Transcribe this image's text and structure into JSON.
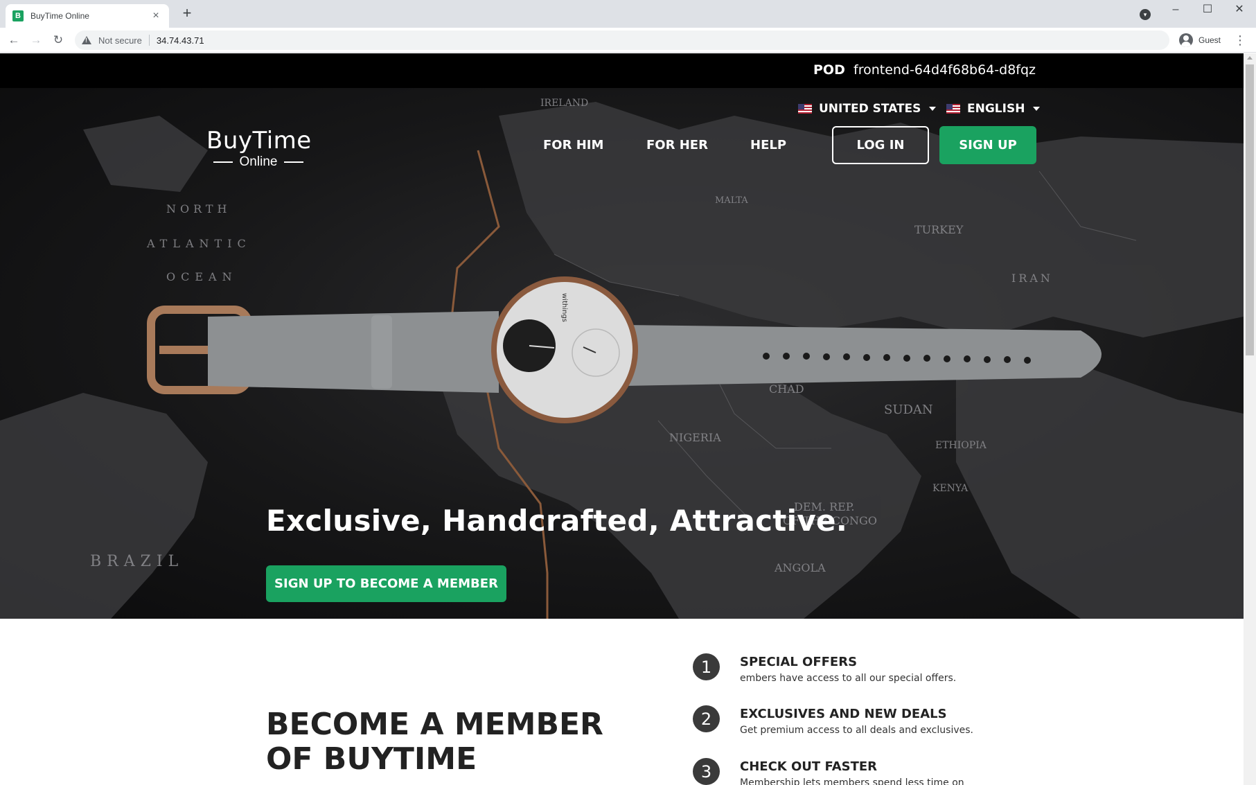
{
  "browser": {
    "tab_title": "BuyTime Online",
    "favicon_letter": "B",
    "security_label": "Not secure",
    "url": "34.74.43.71",
    "profile_label": "Guest"
  },
  "pod": {
    "label": "POD",
    "value": "frontend-64d4f68b64-d8fqz"
  },
  "topnav": {
    "country": "UNITED STATES",
    "language": "ENGLISH"
  },
  "brand": {
    "name": "BuyTime",
    "sub": "Online"
  },
  "nav": {
    "for_him": "FOR HIM",
    "for_her": "FOR HER",
    "help": "HELP",
    "login": "LOG IN",
    "signup": "SIGN UP"
  },
  "hero": {
    "headline": "Exclusive, Handcrafted, Attractive.",
    "cta": "SIGN UP TO BECOME A MEMBER",
    "watch_brand": "withings"
  },
  "member": {
    "title_line1": "BECOME A MEMBER",
    "title_line2": "OF BUYTIME",
    "features": [
      {
        "num": "1",
        "title": "SPECIAL OFFERS",
        "desc": "embers have access to all our special offers."
      },
      {
        "num": "2",
        "title": "EXCLUSIVES AND NEW DEALS",
        "desc": "Get premium access to all deals and exclusives."
      },
      {
        "num": "3",
        "title": "CHECK OUT FASTER",
        "desc": "Membership lets members spend less time on"
      }
    ]
  },
  "colors": {
    "accent": "#1aa260",
    "pod_bar": "#000000",
    "hero_bg": "#151516"
  }
}
